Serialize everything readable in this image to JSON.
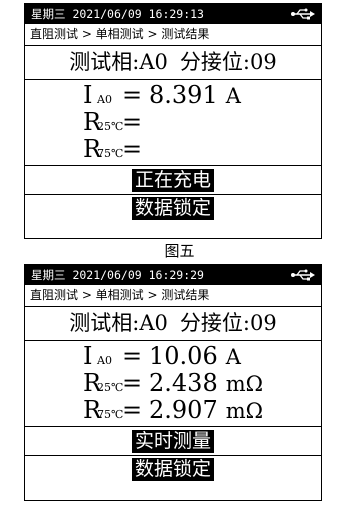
{
  "screens": [
    {
      "status": {
        "day": "星期三",
        "datetime": "2021/06/09 16:29:13",
        "usb_icon": "usb-icon"
      },
      "breadcrumb": "直阻测试 > 单相测试 > 测试结果",
      "phase_label": "测试相:A0",
      "tap_label": "分接位:09",
      "current": {
        "symbol": "I",
        "sub": "A0",
        "eq": "=",
        "value": "8.391",
        "unit": "A"
      },
      "r25": {
        "symbol": "R",
        "sub": "25℃",
        "eq": "=",
        "value": "",
        "unit": ""
      },
      "r75": {
        "symbol": "R",
        "sub": "75℃",
        "eq": "=",
        "value": "",
        "unit": ""
      },
      "button1": "正在充电",
      "button2": "数据锁定"
    },
    {
      "status": {
        "day": "星期三",
        "datetime": "2021/06/09 16:29:29",
        "usb_icon": "usb-icon"
      },
      "breadcrumb": "直阻测试 > 单相测试 > 测试结果",
      "phase_label": "测试相:A0",
      "tap_label": "分接位:09",
      "current": {
        "symbol": "I",
        "sub": "A0",
        "eq": "=",
        "value": "10.06",
        "unit": "A"
      },
      "r25": {
        "symbol": "R",
        "sub": "25℃",
        "eq": "=",
        "value": "2.438",
        "unit": "mΩ"
      },
      "r75": {
        "symbol": "R",
        "sub": "75℃",
        "eq": "=",
        "value": "2.907",
        "unit": "mΩ"
      },
      "button1": "实时测量",
      "button2": "数据锁定"
    }
  ],
  "caption": "图五"
}
